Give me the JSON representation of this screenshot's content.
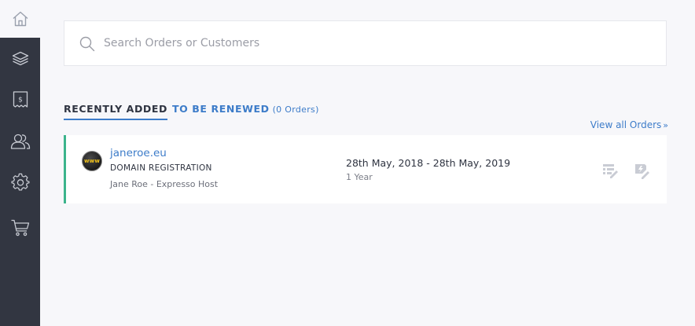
{
  "sidebar": {
    "items": [
      {
        "name": "home",
        "icon": "home-icon"
      },
      {
        "name": "products",
        "icon": "layers-icon"
      },
      {
        "name": "billing",
        "icon": "receipt-icon"
      },
      {
        "name": "customers",
        "icon": "users-icon"
      },
      {
        "name": "settings",
        "icon": "gear-icon"
      },
      {
        "name": "cart",
        "icon": "cart-icon"
      }
    ]
  },
  "search": {
    "placeholder": "Search Orders or Customers"
  },
  "tabs": {
    "recently_added": "RECENTLY ADDED",
    "to_be_renewed": "TO BE RENEWED",
    "to_be_renewed_count": "(0 Orders)"
  },
  "view_all": {
    "label": "View all Orders",
    "chevron": "»"
  },
  "orders": [
    {
      "domain": "janeroe.eu",
      "product_type": "DOMAIN REGISTRATION",
      "customer": "Jane Roe - Expresso Host",
      "date_range": "28th May, 2018 - 28th May, 2019",
      "duration": "1 Year",
      "icon_text": "www"
    }
  ],
  "colors": {
    "sidebar_bg": "#323641",
    "accent_blue": "#3d7cc9",
    "active_border_green": "#3cb48c",
    "page_bg": "#f7f7fa"
  }
}
